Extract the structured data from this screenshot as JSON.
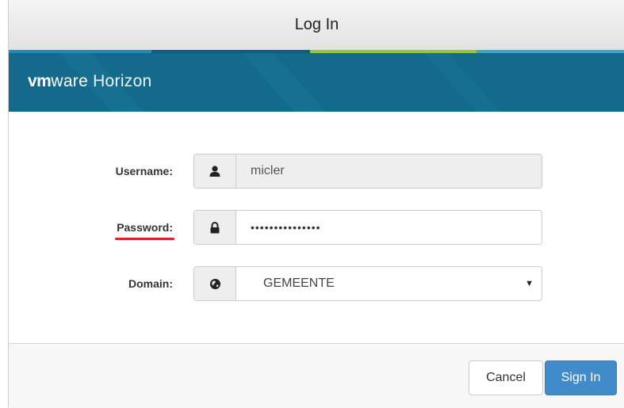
{
  "dialog": {
    "title": "Log In"
  },
  "banner": {
    "brand_vm": "vm",
    "brand_ware": "ware",
    "product": "Horizon"
  },
  "form": {
    "username": {
      "label": "Username:",
      "value": "micler",
      "icon": "user-icon"
    },
    "password": {
      "label": "Password:",
      "value": "•••••••••••••••",
      "icon": "lock-icon"
    },
    "domain": {
      "label": "Domain:",
      "value": "GEMEENTE",
      "icon": "globe-icon"
    }
  },
  "footer": {
    "cancel_label": "Cancel",
    "signin_label": "Sign In"
  },
  "colors": {
    "banner": "#136a8a",
    "primary_button": "#428bca",
    "annotation_underline": "#d9252a"
  }
}
